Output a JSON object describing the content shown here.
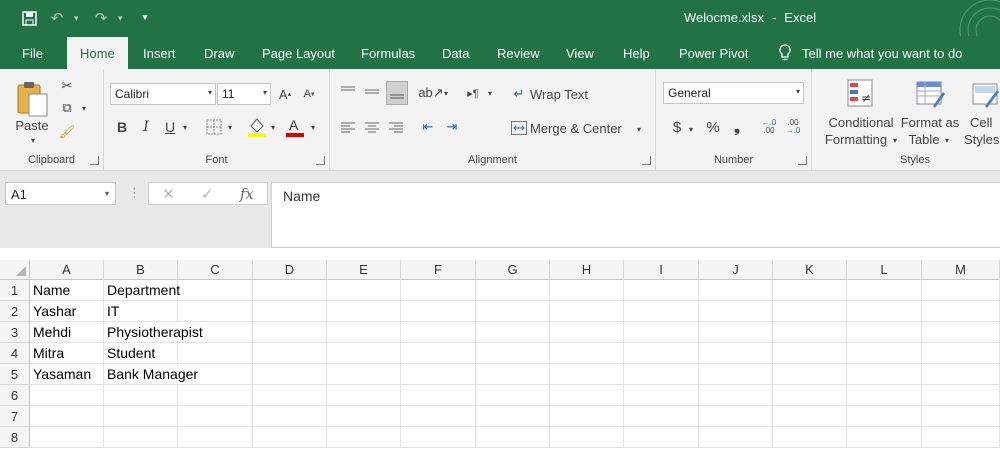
{
  "window": {
    "file_name": "Welocme.xlsx",
    "separator": "-",
    "app_name": "Excel"
  },
  "tabs": [
    "File",
    "Home",
    "Insert",
    "Draw",
    "Page Layout",
    "Formulas",
    "Data",
    "Review",
    "View",
    "Help",
    "Power Pivot"
  ],
  "active_tab": "Home",
  "tell_me": "Tell me what you want to do",
  "ribbon": {
    "clipboard": {
      "paste_label": "Paste",
      "group_label": "Clipboard"
    },
    "font": {
      "font_name": "Calibri",
      "font_size": "11",
      "bold": "B",
      "italic": "I",
      "underline": "U",
      "group_label": "Font"
    },
    "alignment": {
      "wrap_text": "Wrap Text",
      "merge_center": "Merge & Center",
      "group_label": "Alignment"
    },
    "number": {
      "format": "General",
      "currency": "$",
      "percent": "%",
      "comma": "❟",
      "inc_decimal": ".00",
      "dec_decimal": ".00",
      "group_label": "Number"
    },
    "styles": {
      "conditional_1": "Conditional",
      "conditional_2": "Formatting",
      "format_as_1": "Format as",
      "format_as_2": "Table",
      "cell_styles_1": "Cell",
      "cell_styles_2": "Styles",
      "group_label": "Styles"
    }
  },
  "formula_bar": {
    "name_box": "A1",
    "content": "Name"
  },
  "columns": [
    "A",
    "B",
    "C",
    "D",
    "E",
    "F",
    "G",
    "H",
    "I",
    "J",
    "K",
    "L",
    "M"
  ],
  "rows": [
    {
      "num": "1",
      "a": "Name",
      "b": "Department"
    },
    {
      "num": "2",
      "a": "Yashar",
      "b": "IT"
    },
    {
      "num": "3",
      "a": "Mehdi",
      "b": "Physiotherapist"
    },
    {
      "num": "4",
      "a": "Mitra",
      "b": "Student"
    },
    {
      "num": "5",
      "a": "Yasaman",
      "b": "Bank Manager"
    },
    {
      "num": "6",
      "a": "",
      "b": ""
    },
    {
      "num": "7",
      "a": "",
      "b": ""
    },
    {
      "num": "8",
      "a": "",
      "b": ""
    }
  ],
  "colors": {
    "brand": "#217346",
    "ribbon_bg": "#f3f3f3"
  }
}
